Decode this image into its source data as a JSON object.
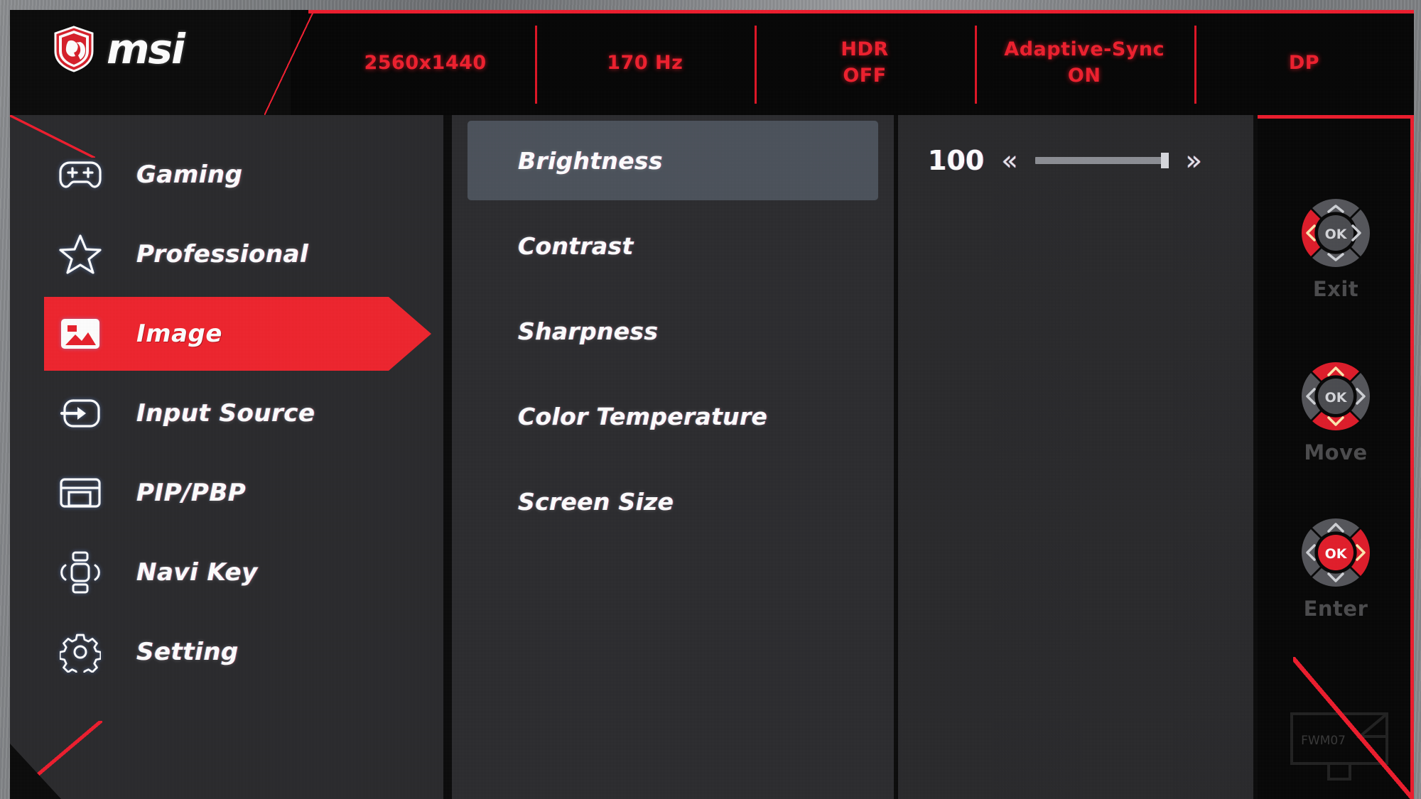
{
  "brand": {
    "name": "msi",
    "logo_icon": "msi-dragon-shield-icon"
  },
  "status_bar": {
    "items": [
      {
        "icon": "resolution-indicator",
        "lines": [
          "2560x1440"
        ]
      },
      {
        "icon": "refresh-rate-indicator",
        "lines": [
          "170 Hz"
        ]
      },
      {
        "icon": "hdr-indicator",
        "lines": [
          "HDR",
          "OFF"
        ]
      },
      {
        "icon": "adaptive-sync-indicator",
        "lines": [
          "Adaptive-Sync",
          "ON"
        ]
      },
      {
        "icon": "input-indicator",
        "lines": [
          "DP"
        ]
      }
    ]
  },
  "sidebar": {
    "items": [
      {
        "label": "Gaming",
        "icon": "gamepad-icon",
        "active": false
      },
      {
        "label": "Professional",
        "icon": "star-icon",
        "active": false
      },
      {
        "label": "Image",
        "icon": "picture-icon",
        "active": true
      },
      {
        "label": "Input Source",
        "icon": "arrow-into-box-icon",
        "active": false
      },
      {
        "label": "PIP/PBP",
        "icon": "windows-split-icon",
        "active": false
      },
      {
        "label": "Navi Key",
        "icon": "navi-key-icon",
        "active": false
      },
      {
        "label": "Setting",
        "icon": "gear-icon",
        "active": false
      }
    ]
  },
  "options": {
    "items": [
      {
        "label": "Brightness",
        "selected": true,
        "value": "100"
      },
      {
        "label": "Contrast",
        "selected": false,
        "value": ""
      },
      {
        "label": "Sharpness",
        "selected": false,
        "value": ""
      },
      {
        "label": "Color Temperature",
        "selected": false,
        "value": ""
      },
      {
        "label": "Screen Size",
        "selected": false,
        "value": ""
      }
    ]
  },
  "value_panel": {
    "value": "100",
    "decrease_icon": "double-chevron-left-icon",
    "increase_icon": "double-chevron-right-icon",
    "decrease_glyph": "«",
    "increase_glyph": "»",
    "slider": {
      "percent": 100,
      "min": 0,
      "max": 100
    }
  },
  "nav_hints": {
    "items": [
      {
        "label": "Exit",
        "icon": "dpad-left-icon",
        "highlight": "left"
      },
      {
        "label": "Move",
        "icon": "dpad-updown-icon",
        "highlight": "updown"
      },
      {
        "label": "Enter",
        "icon": "dpad-ok-icon",
        "highlight": "ok-right"
      }
    ],
    "center_label": "OK"
  },
  "watermark": {
    "text": "FWM07",
    "icon": "monitor-watermark-icon"
  },
  "colors": {
    "accent_red": "#ef1d2e",
    "highlight_red": "#f0242e",
    "panel_dark": "#2a2a2d",
    "panel_mid": "#2c2c2f",
    "selected_gray": "#4b525b",
    "text_white": "#ffffff",
    "status_red": "#f01f2e"
  }
}
